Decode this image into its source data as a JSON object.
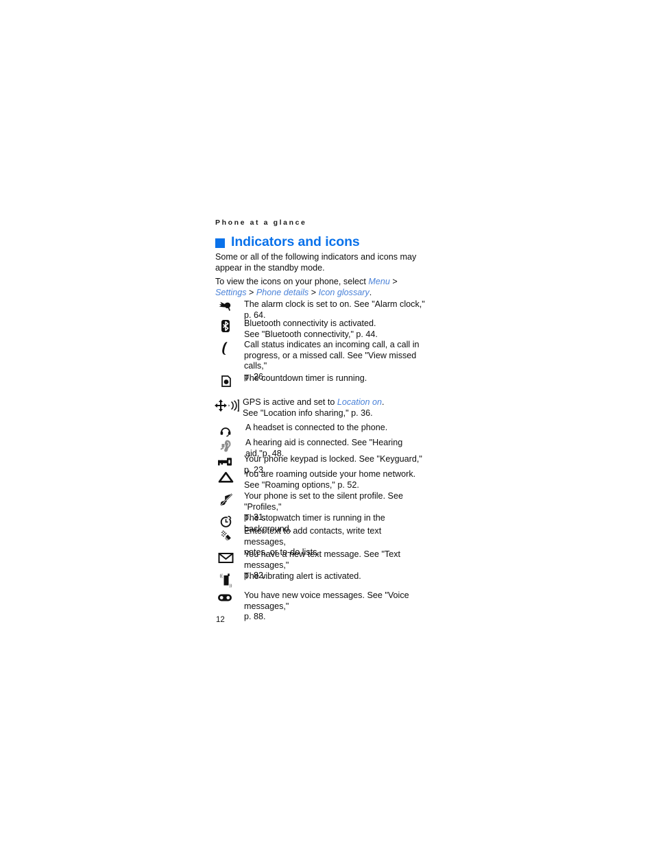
{
  "document": {
    "running_header": "Phone at a glance",
    "page_number": "12",
    "heading": "Indicators and icons",
    "heading_color": "#0a72ea",
    "link_color": "#4a82d8",
    "intro_1": "Some or all of the following indicators and icons may appear in the standby mode.",
    "intro_2_prefix": "To view the icons on your phone, select ",
    "intro_2_path": [
      {
        "label": "Menu",
        "sep": " > "
      },
      {
        "label": "Settings",
        "sep": " > "
      },
      {
        "label": "Phone details",
        "sep": " > "
      },
      {
        "label": "Icon glossary",
        "sep": "."
      }
    ]
  },
  "icons": [
    {
      "icon": "alarm-clock-icon",
      "lines": [
        "The alarm clock is set to on. See \"Alarm clock,\" p. 64."
      ]
    },
    {
      "icon": "bluetooth-icon",
      "lines": [
        "Bluetooth connectivity is activated.",
        "See \"Bluetooth connectivity,\" p. 44."
      ]
    },
    {
      "icon": "call-status-icon",
      "lines": [
        "Call status indicates an incoming call, a call in",
        "progress, or a missed call.  See \"View missed calls,\"",
        "p. 26."
      ]
    },
    {
      "icon": "countdown-timer-icon",
      "lines": [
        "The countdown timer is running."
      ]
    },
    {
      "icon": "gps-icon",
      "lines_rich": true,
      "line1_prefix": "GPS is active and set to ",
      "line1_link": "Location on",
      "line1_suffix": ".",
      "lines": [
        "GPS is active and set to Location on.",
        "See \"Location info sharing,\" p. 36."
      ]
    },
    {
      "icon": "headset-icon",
      "lines": [
        " A headset is connected to the phone."
      ]
    },
    {
      "icon": "hearing-aid-icon",
      "lines": [
        " A hearing aid is connected. See \"Hearing aid,\"p. 48."
      ]
    },
    {
      "icon": "keyguard-key-icon",
      "lines": [
        "Your phone keypad is locked. See \"Keyguard,\" p. 23."
      ]
    },
    {
      "icon": "roaming-icon",
      "lines": [
        "You are roaming outside your home network.",
        "See \"Roaming options,\" p. 52."
      ]
    },
    {
      "icon": "silent-profile-icon",
      "lines": [
        "Your phone is set to the silent profile. See \"Profiles,\"",
        "p. 31."
      ]
    },
    {
      "icon": "stopwatch-icon",
      "lines": [
        "The stopwatch timer is running in the background."
      ]
    },
    {
      "icon": "text-entry-icon",
      "lines": [
        "Enter text to add contacts, write text messages,",
        "notes, or to-do lists."
      ]
    },
    {
      "icon": "new-text-message-icon",
      "lines": [
        "You have a new text message. See \"Text messages,\"",
        "p. 82."
      ]
    },
    {
      "icon": "vibrating-alert-icon",
      "lines": [
        "The vibrating alert is activated."
      ]
    },
    {
      "icon": "voice-message-icon",
      "lines": [
        "You have new voice messages. See \"Voice messages,\"",
        "p. 88."
      ]
    }
  ]
}
